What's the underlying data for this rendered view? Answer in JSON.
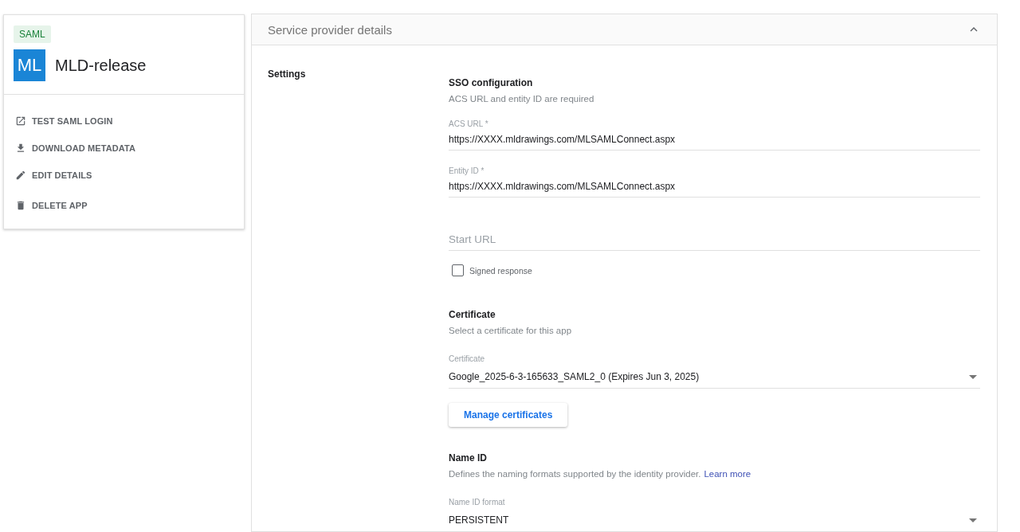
{
  "app_card": {
    "badge": "SAML",
    "avatar": "ML",
    "name": "MLD-release",
    "actions": [
      {
        "kind": "open",
        "label": "TEST SAML LOGIN"
      },
      {
        "kind": "download",
        "label": "DOWNLOAD METADATA"
      },
      {
        "kind": "edit",
        "label": "EDIT DETAILS"
      },
      {
        "kind": "delete",
        "label": "DELETE APP"
      }
    ]
  },
  "panel": {
    "title": "Service provider details",
    "expanded": true,
    "section_label": "Settings",
    "sso": {
      "title": "SSO configuration",
      "subtitle": "ACS URL and entity ID are required",
      "fields": [
        {
          "label": "ACS URL *",
          "value": "https://XXXX.mldrawings.com/MLSAMLConnect.aspx"
        },
        {
          "label": "Entity ID *",
          "value": "https://XXXX.mldrawings.com/MLSAMLConnect.aspx"
        },
        {
          "placeholder": "Start URL"
        }
      ],
      "signed_response": {
        "label": "Signed response",
        "checked": false
      }
    },
    "certificate": {
      "title": "Certificate",
      "subtitle": "Select a certificate for this app",
      "select_label": "Certificate",
      "select_value": "Google_2025-6-3-165633_SAML2_0 (Expires Jun 3, 2025)",
      "button": "Manage certificates"
    },
    "name_id": {
      "title": "Name ID",
      "description": "Defines the naming formats supported by the identity provider.",
      "link": "Learn more",
      "select_label": "Name ID format",
      "select_value": "PERSISTENT"
    }
  }
}
